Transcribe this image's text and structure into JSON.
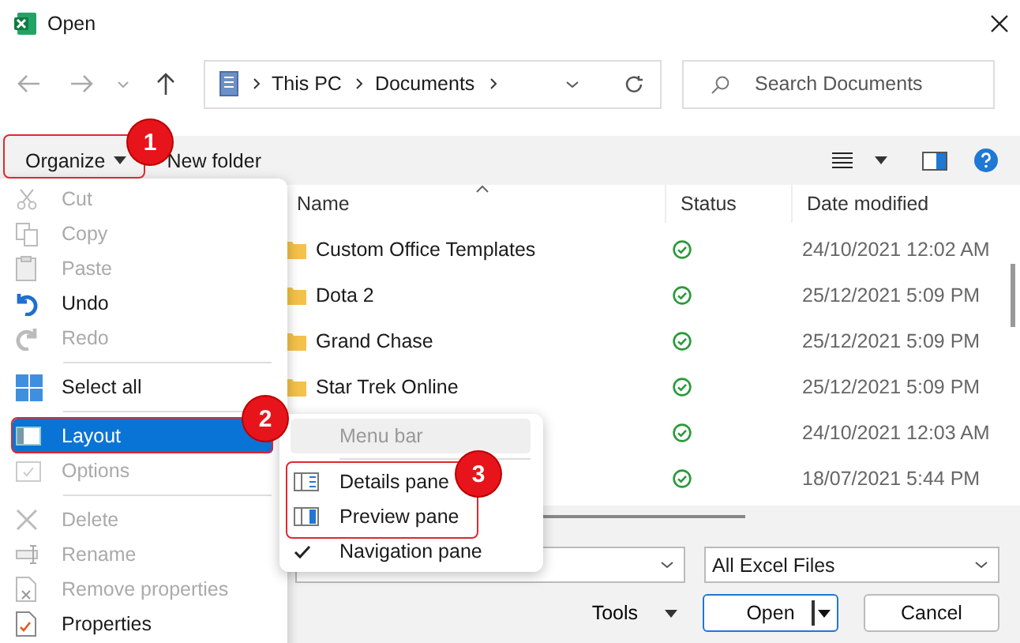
{
  "window": {
    "title": "Open"
  },
  "address": {
    "crumbs": [
      "This PC",
      "Documents"
    ]
  },
  "search": {
    "placeholder": "Search Documents"
  },
  "toolbar": {
    "organize": "Organize",
    "new_folder": "New folder"
  },
  "table": {
    "columns": [
      "Name",
      "Status",
      "Date modified"
    ],
    "rows": [
      {
        "name": "Custom Office Templates",
        "date": "24/10/2021 12:02 AM"
      },
      {
        "name": "Dota 2",
        "date": "25/12/2021 5:09 PM"
      },
      {
        "name": "Grand Chase",
        "date": "25/12/2021 5:09 PM"
      },
      {
        "name": "Star Trek Online",
        "date": "25/12/2021 5:09 PM"
      },
      {
        "date": "24/10/2021 12:03 AM"
      },
      {
        "date": "18/07/2021 5:44 PM"
      }
    ]
  },
  "organize_menu": [
    {
      "kind": "item",
      "label": "Cut",
      "disabled": true,
      "selected": false
    },
    {
      "kind": "item",
      "label": "Copy",
      "disabled": true,
      "selected": false
    },
    {
      "kind": "item",
      "label": "Paste",
      "disabled": true,
      "selected": false
    },
    {
      "kind": "item",
      "label": "Undo",
      "disabled": false,
      "selected": false
    },
    {
      "kind": "item",
      "label": "Redo",
      "disabled": true,
      "selected": false
    },
    {
      "kind": "separator"
    },
    {
      "kind": "item",
      "label": "Select all",
      "disabled": false,
      "selected": false
    },
    {
      "kind": "separator"
    },
    {
      "kind": "item",
      "label": "Layout",
      "disabled": false,
      "selected": true
    },
    {
      "kind": "item",
      "label": "Options",
      "disabled": true,
      "selected": false
    },
    {
      "kind": "separator"
    },
    {
      "kind": "item",
      "label": "Delete",
      "disabled": true,
      "selected": false
    },
    {
      "kind": "item",
      "label": "Rename",
      "disabled": true,
      "selected": false
    },
    {
      "kind": "item",
      "label": "Remove properties",
      "disabled": true,
      "selected": false
    },
    {
      "kind": "item",
      "label": "Properties",
      "disabled": false,
      "selected": false
    }
  ],
  "layout_menu": [
    {
      "kind": "item",
      "label": "Menu bar",
      "disabled": true,
      "checked": false
    },
    {
      "kind": "separator"
    },
    {
      "kind": "item",
      "label": "Details pane",
      "disabled": false,
      "checked": false
    },
    {
      "kind": "item",
      "label": "Preview pane",
      "disabled": false,
      "checked": false
    },
    {
      "kind": "item",
      "label": "Navigation pane",
      "disabled": false,
      "checked": true
    }
  ],
  "filter": {
    "value": "All Excel Files"
  },
  "buttons": {
    "tools": "Tools",
    "open": "Open",
    "cancel": "Cancel"
  },
  "annotations": [
    {
      "number": "1"
    },
    {
      "number": "2"
    },
    {
      "number": "3"
    }
  ]
}
